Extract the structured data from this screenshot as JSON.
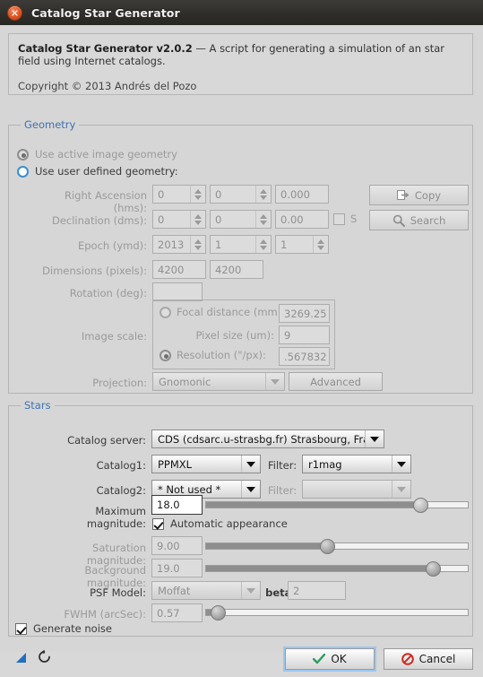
{
  "window": {
    "title": "Catalog Star Generator",
    "close_icon": "close-icon"
  },
  "info": {
    "version_line_bold": "Catalog Star Generator v2.0.2",
    "version_line_rest": " — A script for generating a simulation of an star field using Internet catalogs.",
    "copyright": "Copyright © 2013 Andrés del Pozo"
  },
  "geometry": {
    "legend": "Geometry",
    "radio_active": "Use active image geometry",
    "radio_user": "Use user defined geometry:",
    "right_ascension": {
      "label": "Right Ascension (hms):",
      "h": "0",
      "m": "0",
      "s": "0.000"
    },
    "declination": {
      "label": "Declination (dms):",
      "d": "0",
      "m": "0",
      "s": "0.00",
      "south_label": "S"
    },
    "epoch": {
      "label": "Epoch (ymd):",
      "y": "2013",
      "m": "1",
      "d": "1"
    },
    "dimensions": {
      "label": "Dimensions (pixels):",
      "w": "4200",
      "h": "4200"
    },
    "rotation": {
      "label": "Rotation (deg):",
      "value": ""
    },
    "image_scale": {
      "label": "Image scale:",
      "focal_label": "Focal distance (mm):",
      "focal_value": "3269.25",
      "pixel_label": "Pixel size (um):",
      "pixel_value": "9",
      "resolution_label": "Resolution (\"/px):",
      "resolution_value": ".567832"
    },
    "projection": {
      "label": "Projection:",
      "value": "Gnomonic",
      "advanced_button": "Advanced"
    },
    "copy_button": "Copy",
    "search_button": "Search"
  },
  "stars": {
    "legend": "Stars",
    "catalog_server": {
      "label": "Catalog server:",
      "value": "CDS (cdsarc.u-strasbg.fr) Strasbourg, Frai"
    },
    "catalog1": {
      "label": "Catalog1:",
      "value": "PPMXL",
      "filter_label": "Filter:",
      "filter_value": "r1mag"
    },
    "catalog2": {
      "label": "Catalog2:",
      "value": "* Not used *",
      "filter_label": "Filter:",
      "filter_value": ""
    },
    "maximum_magnitude": {
      "label": "Maximum magnitude:",
      "value": "18.0",
      "slider_percent": 83
    },
    "automatic_appearance": {
      "label": "Automatic appearance",
      "checked": true
    },
    "saturation_magnitude": {
      "label": "Saturation magnitude:",
      "value": "9.00",
      "slider_percent": 46
    },
    "background_magnitude": {
      "label": "Background magnitude:",
      "value": "19.0",
      "slider_percent": 88
    },
    "psf_model": {
      "label": "PSF Model:",
      "value": "Moffat",
      "beta_label": "beta:",
      "beta_value": "2"
    },
    "fwhm": {
      "label": "FWHM (arcSec):",
      "value": "0.57",
      "slider_percent": 2
    },
    "generate_noise": {
      "label": "Generate noise",
      "checked": true
    }
  },
  "footer": {
    "pointer_icon": "cursor-arrow-icon",
    "reset_icon": "reset-icon",
    "ok_button": "OK",
    "cancel_button": "Cancel"
  }
}
